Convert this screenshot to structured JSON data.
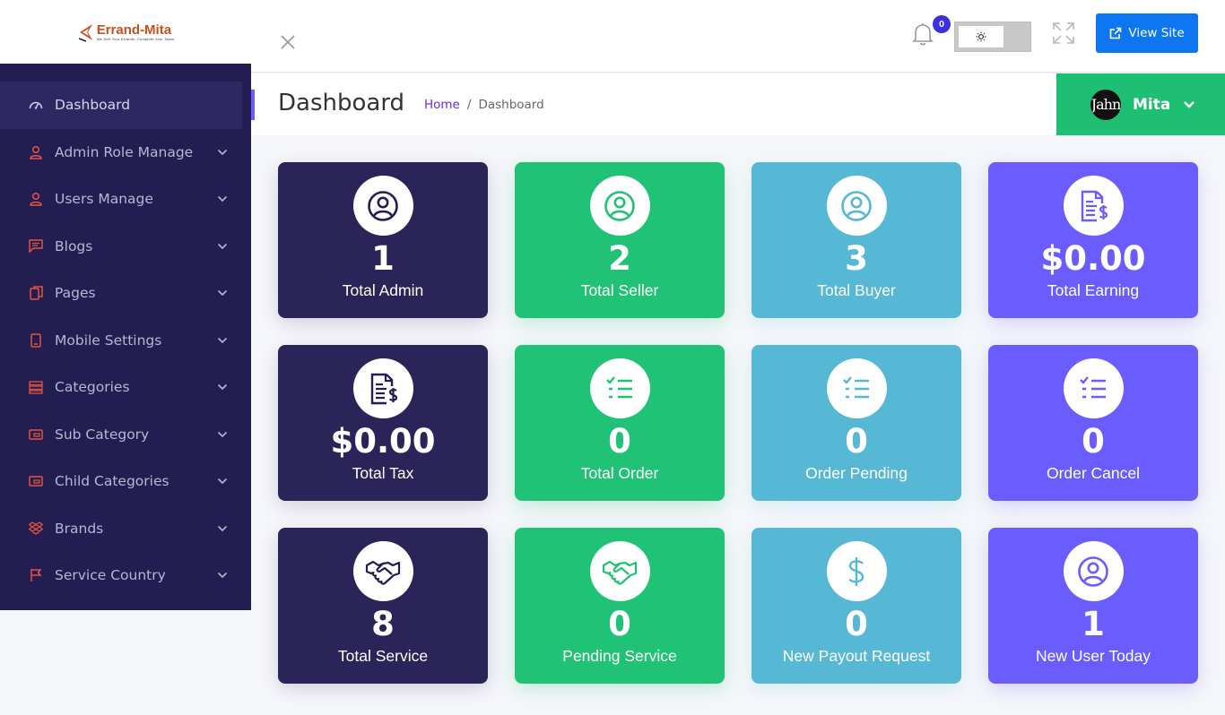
{
  "brand": {
    "name": "Errand-Mita",
    "tagline": "We Sort Your Errands, Complete Your Tasks"
  },
  "sidebar": {
    "items": [
      {
        "label": "Dashboard",
        "icon": "gauge-icon"
      },
      {
        "label": "Admin Role Manage",
        "icon": "user-icon"
      },
      {
        "label": "Users Manage",
        "icon": "user-icon"
      },
      {
        "label": "Blogs",
        "icon": "message-icon"
      },
      {
        "label": "Pages",
        "icon": "pages-icon"
      },
      {
        "label": "Mobile Settings",
        "icon": "mobile-icon"
      },
      {
        "label": "Categories",
        "icon": "list-icon"
      },
      {
        "label": "Sub Category",
        "icon": "card-icon"
      },
      {
        "label": "Child Categories",
        "icon": "card-icon"
      },
      {
        "label": "Brands",
        "icon": "dropbox-icon"
      },
      {
        "label": "Service Country",
        "icon": "flag-icon"
      }
    ]
  },
  "topbar": {
    "notification_count": "0",
    "theme_icon": "sun-icon",
    "view_site_label": "View Site"
  },
  "header": {
    "title": "Dashboard",
    "breadcrumb_home": "Home",
    "breadcrumb_sep": "/",
    "breadcrumb_current": "Dashboard",
    "user_name": "Mita",
    "avatar_text": "Jahn"
  },
  "cards": [
    {
      "value": "1",
      "label": "Total Admin",
      "icon": "user-circle-icon",
      "theme": "navy"
    },
    {
      "value": "2",
      "label": "Total Seller",
      "icon": "user-circle-icon",
      "theme": "green"
    },
    {
      "value": "3",
      "label": "Total Buyer",
      "icon": "user-circle-icon",
      "theme": "sky"
    },
    {
      "value": "$0.00",
      "label": "Total Earning",
      "icon": "invoice-dollar-icon",
      "theme": "purple"
    },
    {
      "value": "$0.00",
      "label": "Total Tax",
      "icon": "invoice-dollar-icon",
      "theme": "navy"
    },
    {
      "value": "0",
      "label": "Total Order",
      "icon": "checklist-icon",
      "theme": "green"
    },
    {
      "value": "0",
      "label": "Order Pending",
      "icon": "checklist-icon",
      "theme": "sky"
    },
    {
      "value": "0",
      "label": "Order Cancel",
      "icon": "checklist-icon",
      "theme": "purple"
    },
    {
      "value": "8",
      "label": "Total Service",
      "icon": "handshake-icon",
      "theme": "navy"
    },
    {
      "value": "0",
      "label": "Pending Service",
      "icon": "handshake-icon",
      "theme": "green"
    },
    {
      "value": "0",
      "label": "New Payout Request",
      "icon": "dollar-icon",
      "theme": "sky"
    },
    {
      "value": "1",
      "label": "New User Today",
      "icon": "user-circle-icon",
      "theme": "purple"
    }
  ],
  "colors": {
    "sidebar_bg": "#231d52",
    "sidebar_icon": "#e2553f",
    "navy": "#2b2458",
    "green": "#20c375",
    "sky": "#57b8d6",
    "purple": "#6a5cff",
    "primary_button": "#0d76f0"
  }
}
